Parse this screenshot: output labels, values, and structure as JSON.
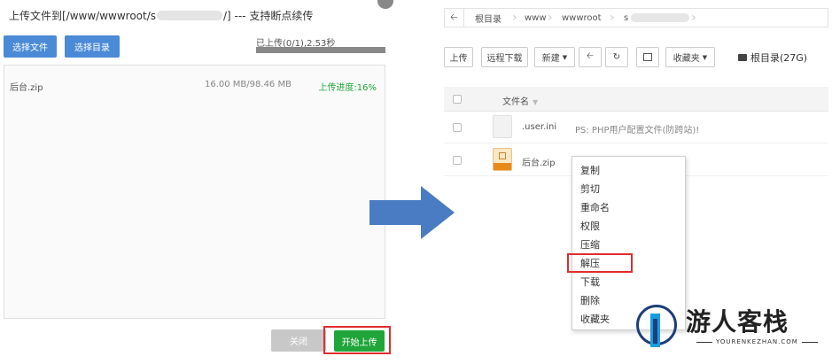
{
  "upload_dialog": {
    "title_prefix": "上传文件到[/www/wwwroot/s",
    "title_suffix": "/] --- 支持断点续传",
    "select_file_label": "选择文件",
    "select_dir_label": "选择目录",
    "upload_status": "已上传(0/1),2.53秒",
    "overall_progress": 1.0,
    "file": {
      "name": "后台.zip",
      "size": "16.00 MB/98.46 MB",
      "progress": "上传进度:16%"
    },
    "close_label": "关闭",
    "start_upload_label": "开始上传"
  },
  "file_manager": {
    "breadcrumbs": [
      "根目录",
      "www",
      "wwwroot",
      "s"
    ],
    "toolbar": {
      "upload": "上传",
      "remote_download": "远程下载",
      "new": "新建",
      "favorites": "收藏夹",
      "disk": "根目录(27G)"
    },
    "table_header": "文件名",
    "files": [
      {
        "name": ".user.ini",
        "note": "PS: PHP用户配置文件(防跨站)!"
      },
      {
        "name": "后台.zip",
        "note": ""
      }
    ],
    "context_menu": [
      "复制",
      "剪切",
      "重命名",
      "权限",
      "压缩",
      "解压",
      "下载",
      "删除",
      "收藏夹"
    ],
    "highlighted_menu_item": "解压"
  },
  "watermark": {
    "name": "游人客栈",
    "url": "YOURENKEZHAN.COM"
  },
  "colors": {
    "accent_blue": "#4b8ad6",
    "success_green": "#20a53a",
    "highlight_red": "#e02d2d",
    "arrow_blue": "#4a7cc4"
  },
  "icons": [
    "back-arrow-icon",
    "refresh-icon",
    "terminal-icon",
    "disk-icon",
    "zip-file-icon",
    "blank-file-icon",
    "arrow-right-icon"
  ]
}
